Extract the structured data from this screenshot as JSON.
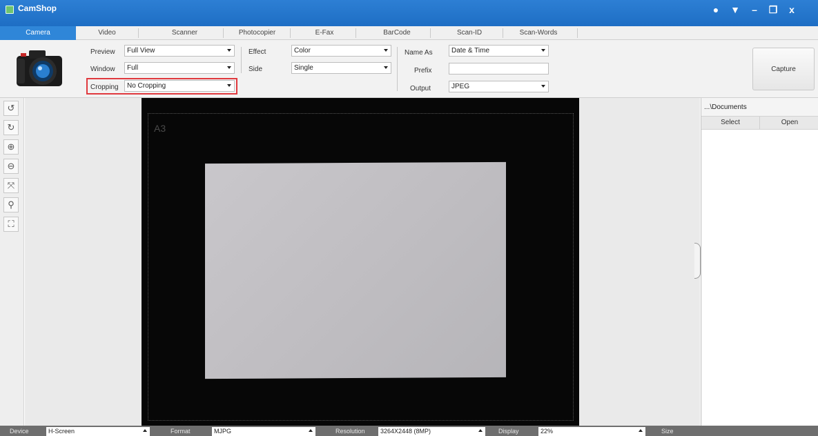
{
  "window": {
    "title": "CamShop"
  },
  "tabs": [
    {
      "label": "Camera",
      "active": true
    },
    {
      "label": "Video"
    },
    {
      "label": "Scanner"
    },
    {
      "label": "Photocopier"
    },
    {
      "label": "E-Fax"
    },
    {
      "label": "BarCode"
    },
    {
      "label": "Scan-ID"
    },
    {
      "label": "Scan-Words"
    }
  ],
  "settings": {
    "preview": {
      "label": "Preview",
      "value": "Full View"
    },
    "window": {
      "label": "Window",
      "value": "Full"
    },
    "cropping": {
      "label": "Cropping",
      "value": "No Cropping"
    },
    "effect": {
      "label": "Effect",
      "value": "Color"
    },
    "side": {
      "label": "Side",
      "value": "Single"
    },
    "name_as": {
      "label": "Name As",
      "value": "Date & Time"
    },
    "prefix": {
      "label": "Prefix",
      "value": ""
    },
    "output": {
      "label": "Output",
      "value": "JPEG"
    },
    "capture_label": "Capture"
  },
  "preview": {
    "paper_size_label": "A3"
  },
  "right_panel": {
    "path": "...\\Documents",
    "select_label": "Select",
    "open_label": "Open"
  },
  "statusbar": {
    "device": {
      "label": "Device",
      "value": "H-Screen"
    },
    "format": {
      "label": "Format",
      "value": "MJPG"
    },
    "resolution": {
      "label": "Resolution",
      "value": "3264X2448 (8MP)"
    },
    "display": {
      "label": "Display",
      "value": "22%"
    },
    "size": {
      "label": "Size"
    }
  },
  "colors": {
    "titlebar": "#1e6ec4",
    "active_tab": "#2f86d8",
    "highlight": "#e0393e"
  }
}
